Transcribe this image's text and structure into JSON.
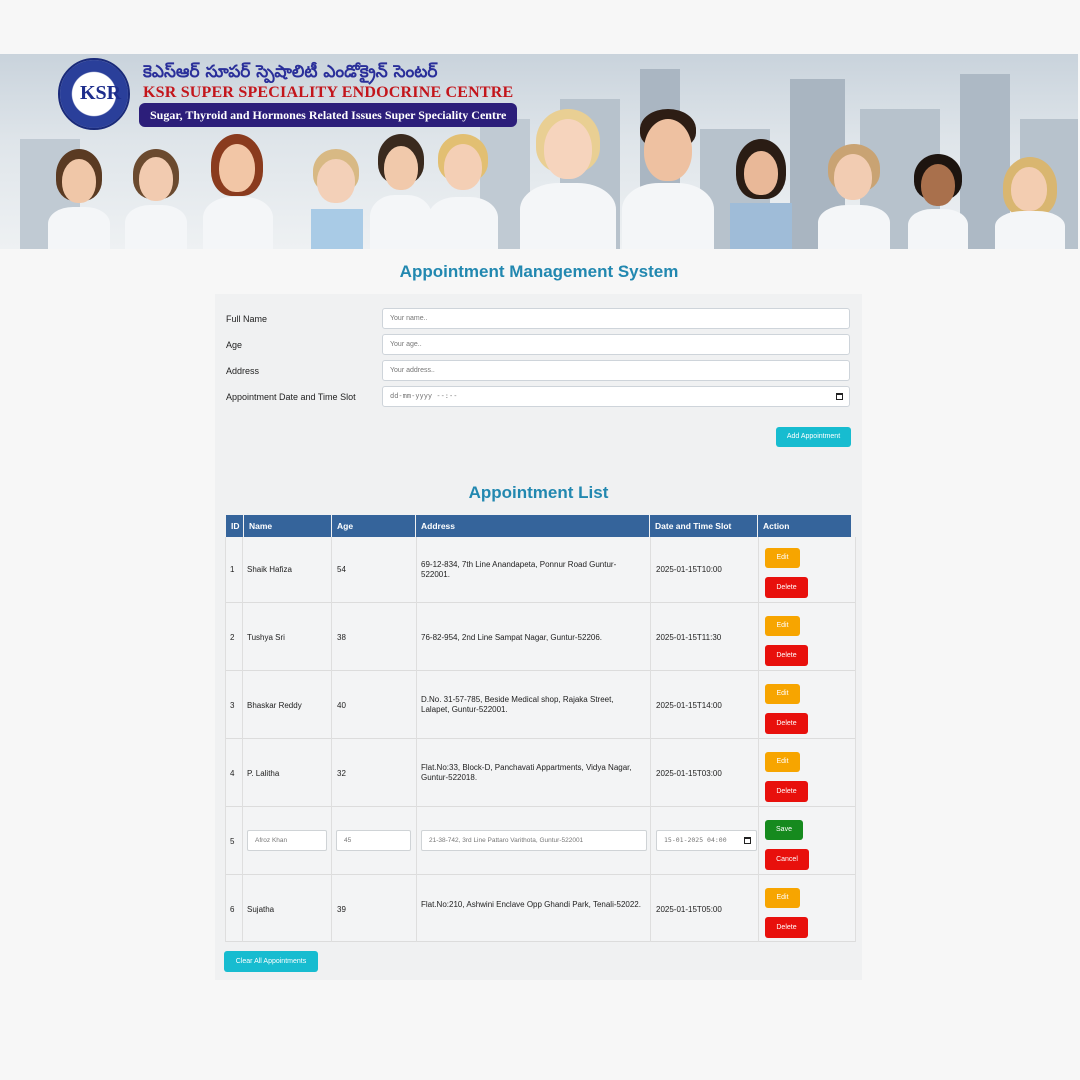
{
  "header": {
    "telugu_name": "కెఎస్ఆర్ సూపర్ స్పెషాలిటీ ఎండోక్రైన్ సెంటర్",
    "brand_name": "KSR SUPER SPECIALITY ENDOCRINE CENTRE",
    "tagline": "Sugar, Thyroid and Hormones Related Issues Super Speciality Centre",
    "logo_text": "KSR",
    "logo_icon": "ksr-logo-icon"
  },
  "app_title": "Appointment Management System",
  "form": {
    "full_name_label": "Full Name",
    "full_name_placeholder": "Your name..",
    "age_label": "Age",
    "age_placeholder": "Your age..",
    "address_label": "Address",
    "address_placeholder": "Your address..",
    "datetime_label": "Appointment Date and Time Slot",
    "datetime_placeholder": "dd-mm-yyyy --:--",
    "add_button": "Add Appointment"
  },
  "list_title": "Appointment List",
  "table": {
    "headers": [
      "ID",
      "Name",
      "Age",
      "Address",
      "Date and Time Slot",
      "Action"
    ],
    "rows": [
      {
        "id": "1",
        "name": "Shaik Hafiza",
        "age": "54",
        "address": "69-12-834, 7th Line Anandapeta, Ponnur Road Guntur-522001.",
        "slot": "2025-01-15T10:00",
        "primary_action": "Edit",
        "secondary_action": "Delete"
      },
      {
        "id": "2",
        "name": "Tushya Sri",
        "age": "38",
        "address": "76-82-954, 2nd Line Sampat Nagar, Guntur-52206.",
        "slot": "2025-01-15T11:30",
        "primary_action": "Edit",
        "secondary_action": "Delete"
      },
      {
        "id": "3",
        "name": "Bhaskar Reddy",
        "age": "40",
        "address": "D.No. 31-57-785, Beside Medical shop, Rajaka Street, Lalapet, Guntur-522001.",
        "slot": "2025-01-15T14:00",
        "primary_action": "Edit",
        "secondary_action": "Delete"
      },
      {
        "id": "4",
        "name": "P. Lalitha",
        "age": "32",
        "address": "Flat.No:33, Block-D, Panchavati Appartments, Vidya Nagar, Guntur-522018.",
        "slot": "2025-01-15T03:00",
        "primary_action": "Edit",
        "secondary_action": "Delete"
      },
      {
        "id": "5",
        "name": "Afroz Khan",
        "age": "45",
        "address": "21-38-742, 3rd Line Pattaro Varithota, Guntur-522001",
        "slot": "15-01-2025 04:00",
        "primary_action": "Save",
        "secondary_action": "Cancel",
        "editing": true
      },
      {
        "id": "6",
        "name": "Sujatha",
        "age": "39",
        "address": "Flat.No:210, Ashwini Enclave Opp Ghandi Park, Tenali-52022.",
        "slot": "2025-01-15T05:00",
        "primary_action": "Edit",
        "secondary_action": "Delete"
      }
    ]
  },
  "clear_button": "Clear All Appointments",
  "colors": {
    "accent_title": "#2288b0",
    "table_header": "#35649b",
    "button_teal": "#17bcd0",
    "button_edit": "#f7a500",
    "button_delete": "#e8100c",
    "button_save": "#168a1e"
  }
}
